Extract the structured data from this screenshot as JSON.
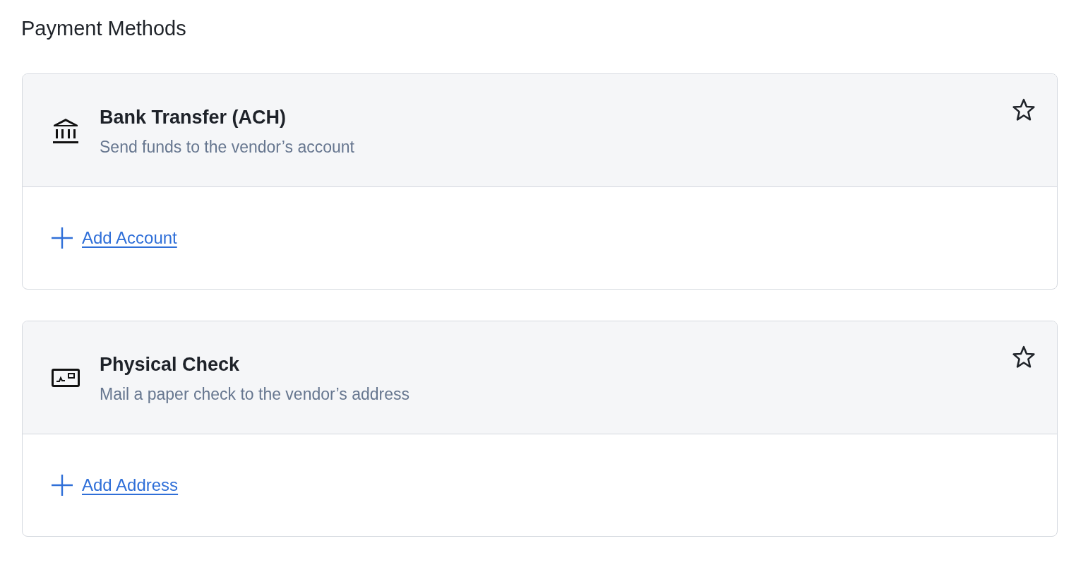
{
  "page": {
    "title": "Payment Methods"
  },
  "methods": [
    {
      "kind": "bank",
      "name": "Bank Transfer (ACH)",
      "description": "Send funds to the vendor’s account",
      "favorite": false,
      "action": "Add Account"
    },
    {
      "kind": "check",
      "name": "Physical Check",
      "description": "Mail a paper check to the vendor’s address",
      "favorite": false,
      "action": "Add Address"
    }
  ]
}
